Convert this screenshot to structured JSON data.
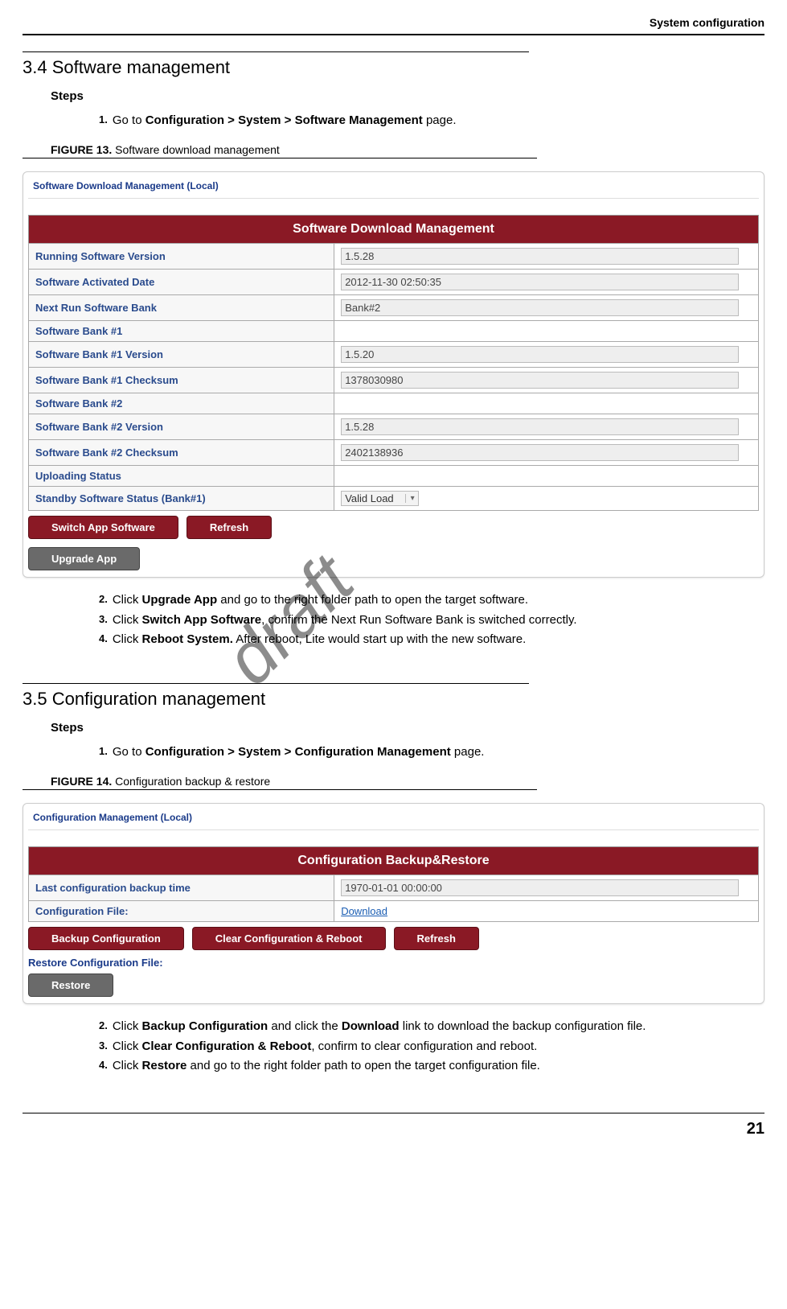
{
  "header": {
    "title": "System configuration"
  },
  "watermark": "draft",
  "section34": {
    "title": "3.4 Software management",
    "steps_label": "Steps",
    "steps": [
      {
        "num": "1.",
        "prefix": "Go to ",
        "bold": "Configuration > System > Software Management",
        "suffix": " page."
      },
      {
        "num": "2.",
        "prefix": "Click ",
        "bold": "Upgrade App",
        "suffix": " and go to the right folder path to open the target software."
      },
      {
        "num": "3.",
        "prefix": "Click ",
        "bold": "Switch App Software",
        "suffix": ", confirm the Next Run Software Bank is switched correctly."
      },
      {
        "num": "4.",
        "prefix": "Click ",
        "bold": "Reboot System.",
        "suffix": " After reboot, Lite would start up with the new software."
      }
    ],
    "figure": {
      "num": "FIGURE 13.",
      "caption": "Software download management"
    }
  },
  "fig13": {
    "window_title": "Software Download Management (Local)",
    "banner": "Software Download Management",
    "rows": [
      {
        "label": "Running Software Version",
        "value": "1.5.28",
        "type": "input"
      },
      {
        "label": "Software Activated Date",
        "value": "2012-11-30 02:50:35",
        "type": "input"
      },
      {
        "label": "Next Run Software Bank",
        "value": "Bank#2",
        "type": "input"
      },
      {
        "label": "Software Bank #1",
        "value": "",
        "type": "blank"
      },
      {
        "label": "Software Bank #1 Version",
        "value": "1.5.20",
        "type": "input"
      },
      {
        "label": "Software Bank #1 Checksum",
        "value": "1378030980",
        "type": "input"
      },
      {
        "label": "Software Bank #2",
        "value": "",
        "type": "blank"
      },
      {
        "label": "Software Bank #2 Version",
        "value": "1.5.28",
        "type": "input"
      },
      {
        "label": "Software Bank #2 Checksum",
        "value": "2402138936",
        "type": "input"
      },
      {
        "label": "Uploading Status",
        "value": "",
        "type": "blank"
      },
      {
        "label": "Standby Software Status (Bank#1)",
        "value": "Valid Load",
        "type": "dropdown"
      }
    ],
    "buttons": {
      "switch": "Switch App Software",
      "refresh": "Refresh",
      "upgrade": "Upgrade App"
    }
  },
  "section35": {
    "title": "3.5 Configuration management",
    "steps_label": "Steps",
    "steps": [
      {
        "num": "1.",
        "prefix": "Go to ",
        "bold": "Configuration > System > Configuration Management",
        "suffix": " page."
      },
      {
        "num": "2.",
        "prefix": "Click ",
        "bold": "Backup Configuration",
        "mid": " and click the ",
        "bold2": "Download",
        "suffix": " link to download the backup configuration file."
      },
      {
        "num": "3.",
        "prefix": "Click ",
        "bold": "Clear Configuration & Reboot",
        "suffix": ", confirm to clear configuration and reboot."
      },
      {
        "num": "4.",
        "prefix": "Click ",
        "bold": "Restore",
        "suffix": " and go to the right folder path to open the target configuration file."
      }
    ],
    "figure": {
      "num": "FIGURE 14.",
      "caption": "Configuration backup & restore"
    }
  },
  "fig14": {
    "window_title": "Configuration Management (Local)",
    "banner": "Configuration Backup&Restore",
    "rows": [
      {
        "label": "Last configuration backup time",
        "value": "1970-01-01 00:00:00",
        "type": "input"
      },
      {
        "label": "Configuration File:",
        "value": "Download",
        "type": "link"
      }
    ],
    "buttons": {
      "backup": "Backup Configuration",
      "clear": "Clear Configuration & Reboot",
      "refresh": "Refresh"
    },
    "restore_label": "Restore Configuration File:",
    "restore_btn": "Restore"
  },
  "page_number": "21"
}
